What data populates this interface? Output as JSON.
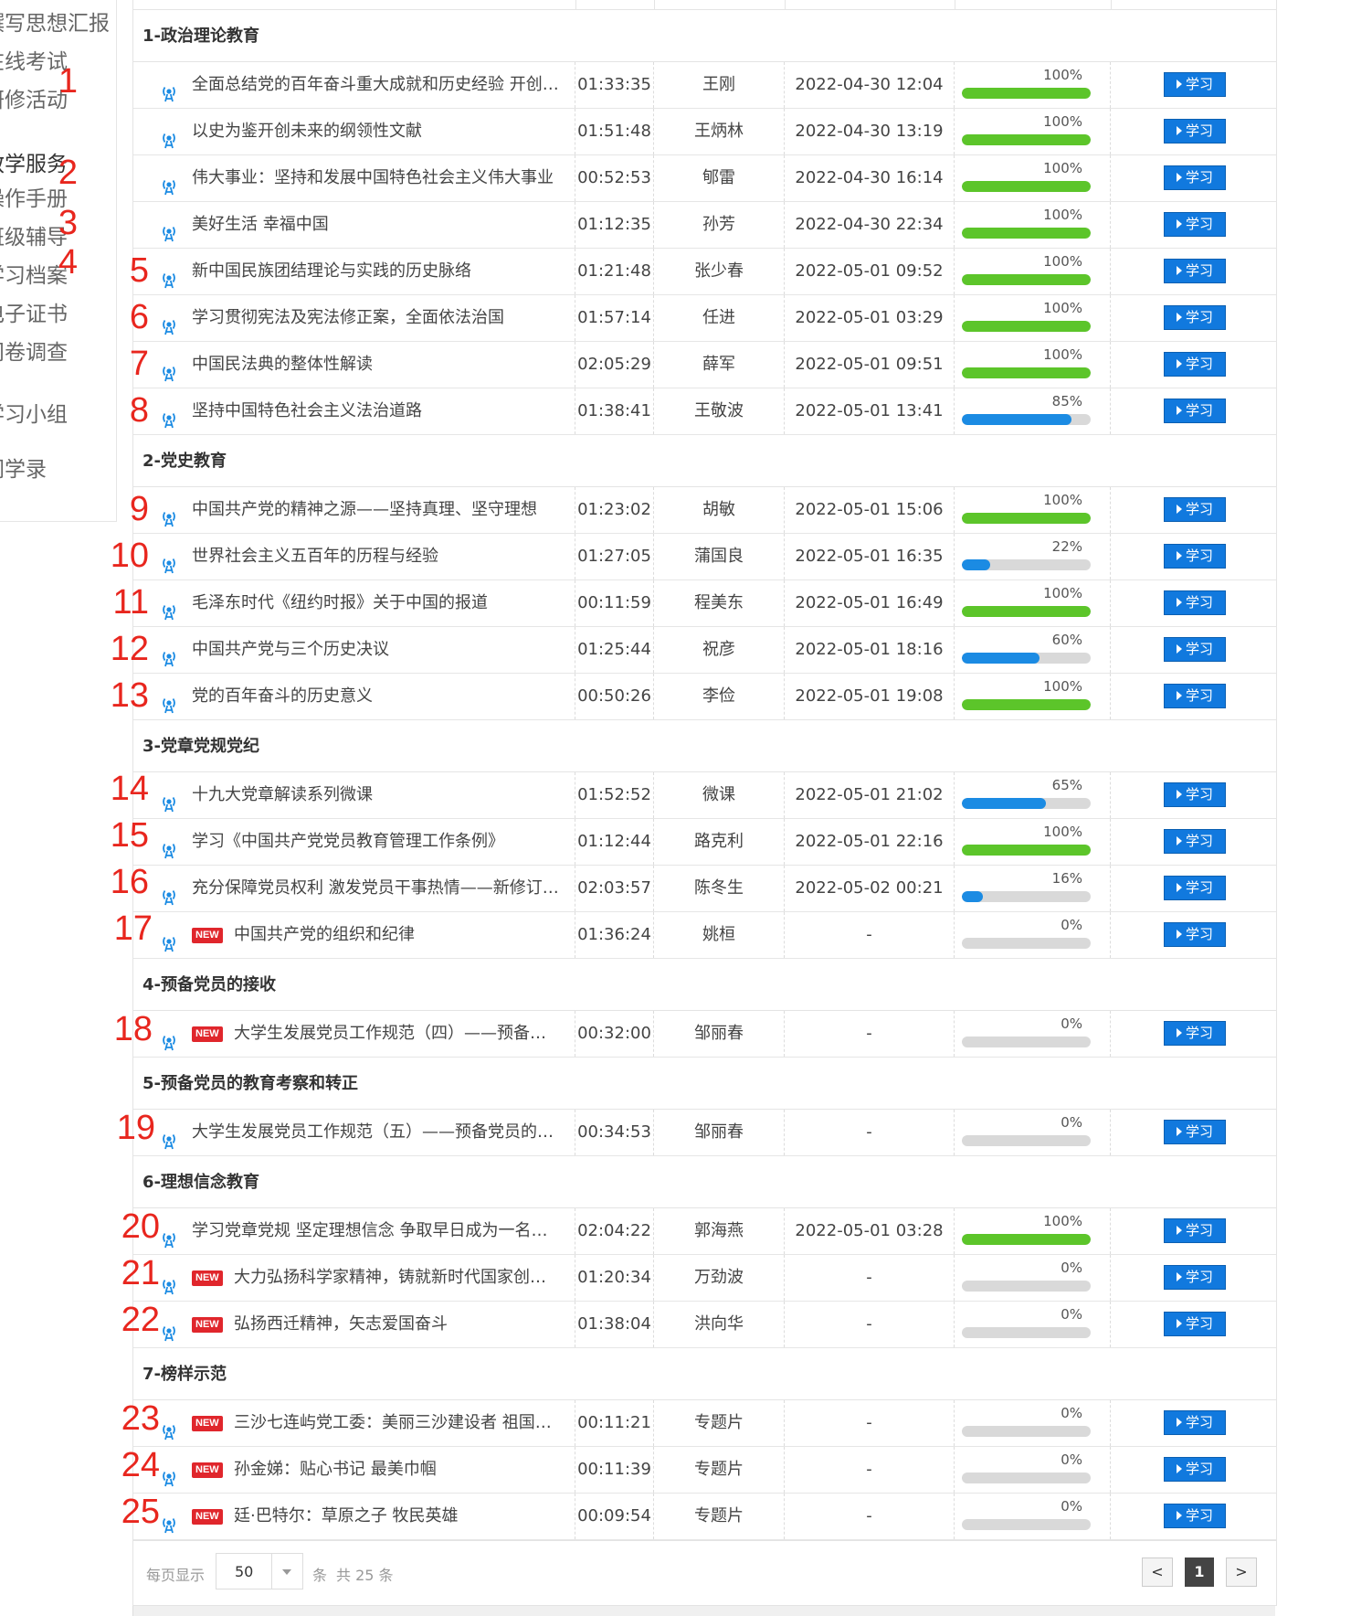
{
  "sidebar": {
    "items": [
      {
        "label": "撰写思想汇报",
        "active": false
      },
      {
        "label": "在线考试",
        "active": false
      },
      {
        "label": "研修活动",
        "active": false
      },
      {
        "label": "教学服务",
        "active": true
      },
      {
        "label": "操作手册",
        "active": false
      },
      {
        "label": "班级辅导",
        "active": false
      },
      {
        "label": "学习档案",
        "active": false
      },
      {
        "label": "电子证书",
        "active": false
      },
      {
        "label": "问卷调查",
        "active": false
      },
      {
        "label": "学习小组",
        "active": false
      },
      {
        "label": "同学录",
        "active": false
      }
    ]
  },
  "groups": [
    {
      "title": "1-政治理论教育",
      "rows": [
        {
          "n": "1",
          "title": "全面总结党的百年奋斗重大成就和历史经验 开创新时代中国特色社会主义新局面",
          "isNew": false,
          "duration": "01:33:35",
          "teacher": "王刚",
          "date": "2022-04-30 12:04",
          "percent": "100%",
          "progress": 1.0,
          "action": "学习"
        },
        {
          "n": "2",
          "title": "以史为鉴开创未来的纲领性文献",
          "isNew": false,
          "duration": "01:51:48",
          "teacher": "王炳林",
          "date": "2022-04-30 13:19",
          "percent": "100%",
          "progress": 1.0,
          "action": "学习"
        },
        {
          "n": "3",
          "title": "伟大事业：坚持和发展中国特色社会主义伟大事业",
          "isNew": false,
          "duration": "00:52:53",
          "teacher": "郇雷",
          "date": "2022-04-30 16:14",
          "percent": "100%",
          "progress": 1.0,
          "action": "学习"
        },
        {
          "n": "4",
          "title": "美好生活 幸福中国",
          "isNew": false,
          "duration": "01:12:35",
          "teacher": "孙芳",
          "date": "2022-04-30 22:34",
          "percent": "100%",
          "progress": 1.0,
          "action": "学习"
        },
        {
          "n": "5",
          "title": "新中国民族团结理论与实践的历史脉络",
          "isNew": false,
          "duration": "01:21:48",
          "teacher": "张少春",
          "date": "2022-05-01 09:52",
          "percent": "100%",
          "progress": 1.0,
          "action": "学习"
        },
        {
          "n": "6",
          "title": "学习贯彻宪法及宪法修正案，全面依法治国",
          "isNew": false,
          "duration": "01:57:14",
          "teacher": "任进",
          "date": "2022-05-01 03:29",
          "percent": "100%",
          "progress": 1.0,
          "action": "学习"
        },
        {
          "n": "7",
          "title": "中国民法典的整体性解读",
          "isNew": false,
          "duration": "02:05:29",
          "teacher": "薛军",
          "date": "2022-05-01 09:51",
          "percent": "100%",
          "progress": 1.0,
          "action": "学习"
        },
        {
          "n": "8",
          "title": "坚持中国特色社会主义法治道路",
          "isNew": false,
          "duration": "01:38:41",
          "teacher": "王敬波",
          "date": "2022-05-01 13:41",
          "percent": "85%",
          "progress": 0.85,
          "action": "学习"
        }
      ]
    },
    {
      "title": "2-党史教育",
      "rows": [
        {
          "n": "9",
          "title": "中国共产党的精神之源——坚持真理、坚守理想",
          "isNew": false,
          "duration": "01:23:02",
          "teacher": "胡敏",
          "date": "2022-05-01 15:06",
          "percent": "100%",
          "progress": 1.0,
          "action": "学习"
        },
        {
          "n": "10",
          "title": "世界社会主义五百年的历程与经验",
          "isNew": false,
          "duration": "01:27:05",
          "teacher": "蒲国良",
          "date": "2022-05-01 16:35",
          "percent": "22%",
          "progress": 0.22,
          "action": "学习"
        },
        {
          "n": "11",
          "title": "毛泽东时代《纽约时报》关于中国的报道",
          "isNew": false,
          "duration": "00:11:59",
          "teacher": "程美东",
          "date": "2022-05-01 16:49",
          "percent": "100%",
          "progress": 1.0,
          "action": "学习"
        },
        {
          "n": "12",
          "title": "中国共产党与三个历史决议",
          "isNew": false,
          "duration": "01:25:44",
          "teacher": "祝彦",
          "date": "2022-05-01 18:16",
          "percent": "60%",
          "progress": 0.6,
          "action": "学习"
        },
        {
          "n": "13",
          "title": "党的百年奋斗的历史意义",
          "isNew": false,
          "duration": "00:50:26",
          "teacher": "李俭",
          "date": "2022-05-01 19:08",
          "percent": "100%",
          "progress": 1.0,
          "action": "学习"
        }
      ]
    },
    {
      "title": "3-党章党规党纪",
      "rows": [
        {
          "n": "14",
          "title": "十九大党章解读系列微课",
          "isNew": false,
          "duration": "01:52:52",
          "teacher": "微课",
          "date": "2022-05-01 21:02",
          "percent": "65%",
          "progress": 0.65,
          "action": "学习"
        },
        {
          "n": "15",
          "title": "学习《中国共产党党员教育管理工作条例》",
          "isNew": false,
          "duration": "01:12:44",
          "teacher": "路克利",
          "date": "2022-05-01 22:16",
          "percent": "100%",
          "progress": 1.0,
          "action": "学习"
        },
        {
          "n": "16",
          "title": "充分保障党员权利 激发党员干事热情——新修订的党员权利保障条例",
          "isNew": false,
          "duration": "02:03:57",
          "teacher": "陈冬生",
          "date": "2022-05-02 00:21",
          "percent": "16%",
          "progress": 0.16,
          "action": "学习"
        },
        {
          "n": "17",
          "title": "中国共产党的组织和纪律",
          "isNew": true,
          "duration": "01:36:24",
          "teacher": "姚桓",
          "date": "-",
          "percent": "0%",
          "progress": 0,
          "action": "学习"
        }
      ]
    },
    {
      "title": "4-预备党员的接收",
      "rows": [
        {
          "n": "18",
          "title": "大学生发展党员工作规范（四）——预备党员的接收",
          "isNew": true,
          "duration": "00:32:00",
          "teacher": "邹丽春",
          "date": "-",
          "percent": "0%",
          "progress": 0,
          "action": "学习"
        }
      ]
    },
    {
      "title": "5-预备党员的教育考察和转正",
      "rows": [
        {
          "n": "19",
          "title": "大学生发展党员工作规范（五）——预备党员的教育考察和转正",
          "isNew": false,
          "duration": "00:34:53",
          "teacher": "邹丽春",
          "date": "-",
          "percent": "0%",
          "progress": 0,
          "action": "学习"
        }
      ]
    },
    {
      "title": "6-理想信念教育",
      "rows": [
        {
          "n": "20",
          "title": "学习党章党规 坚定理想信念 争取早日成为一名合格党员",
          "isNew": false,
          "duration": "02:04:22",
          "teacher": "郭海燕",
          "date": "2022-05-01 03:28",
          "percent": "100%",
          "progress": 1.0,
          "action": "学习"
        },
        {
          "n": "21",
          "title": "大力弘扬科学家精神，铸就新时代国家创新之魂",
          "isNew": true,
          "duration": "01:20:34",
          "teacher": "万劲波",
          "date": "-",
          "percent": "0%",
          "progress": 0,
          "action": "学习"
        },
        {
          "n": "22",
          "title": "弘扬西迁精神，矢志爱国奋斗",
          "isNew": true,
          "duration": "01:38:04",
          "teacher": "洪向华",
          "date": "-",
          "percent": "0%",
          "progress": 0,
          "action": "学习"
        }
      ]
    },
    {
      "title": "7-榜样示范",
      "rows": [
        {
          "n": "23",
          "title": "三沙七连屿党工委：美丽三沙建设者 祖国南海守护人",
          "isNew": true,
          "duration": "00:11:21",
          "teacher": "专题片",
          "date": "-",
          "percent": "0%",
          "progress": 0,
          "action": "学习"
        },
        {
          "n": "24",
          "title": "孙金娣：贴心书记 最美巾帼",
          "isNew": true,
          "duration": "00:11:39",
          "teacher": "专题片",
          "date": "-",
          "percent": "0%",
          "progress": 0,
          "action": "学习"
        },
        {
          "n": "25",
          "title": "廷·巴特尔：草原之子 牧民英雄",
          "isNew": true,
          "duration": "00:09:54",
          "teacher": "专题片",
          "date": "-",
          "percent": "0%",
          "progress": 0,
          "action": "学习"
        }
      ]
    }
  ],
  "new_badge": "NEW",
  "pagination": {
    "per_page_label": "每页显示",
    "per_page_value": "50",
    "unit_label": "条",
    "total_label": "共 25 条",
    "prev": "<",
    "current": "1",
    "next": ">"
  },
  "colors": {
    "complete": "#5cc52a",
    "partial": "#1b8be3",
    "track": "#d9d9d9",
    "button": "#1179de",
    "annotation": "#e8261e",
    "new_badge": "#e0262c"
  }
}
